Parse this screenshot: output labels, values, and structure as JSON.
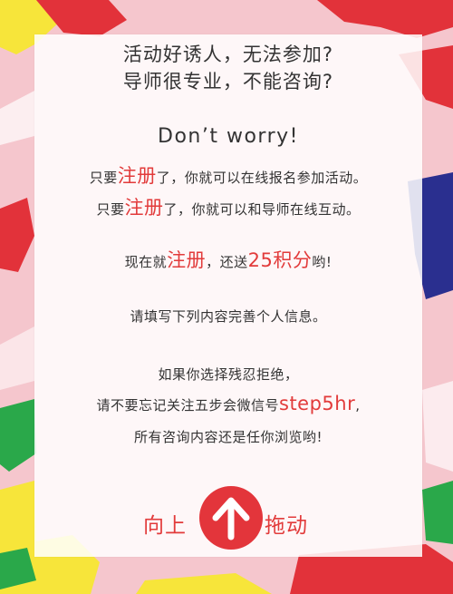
{
  "header": {
    "line1": "活动好诱人，无法参加?",
    "line2": "导师很专业，不能咨询?"
  },
  "worry": "Don’t worry!",
  "register_line1": {
    "pre": "只要",
    "highlight": "注册",
    "post": "了，你就可以在线报名参加活动。"
  },
  "register_line2": {
    "pre": "只要",
    "highlight": "注册",
    "post": "了，你就可以和导师在线互动。"
  },
  "bonus": {
    "pre": "现在就",
    "highlight": "注册",
    "mid": "，还送",
    "points": "25积分",
    "post": "哟!"
  },
  "fill_info": "请填写下列内容完善个人信息。",
  "refuse": {
    "line1": "如果你选择残忍拒绝，",
    "line2_pre": "请不要忘记关注五步会微信号",
    "line2_id": "step5hr",
    "line2_post": ",",
    "line3": "所有咨询内容还是任你浏览哟!"
  },
  "drag": {
    "left": "向上",
    "right": "拖动",
    "icon": "arrow-up-icon"
  },
  "colors": {
    "accent": "#e23b3b",
    "background": "#f5c6cd",
    "yellow": "#f7e53a",
    "navy": "#2a2f8f",
    "green": "#2aa84a"
  }
}
